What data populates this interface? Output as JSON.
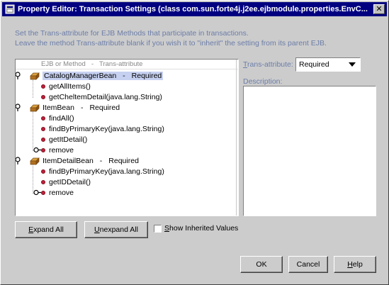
{
  "window": {
    "title": "Property Editor: Transaction Settings (class com.sun.forte4j.j2ee.ejbmodule.properties.EnvC...",
    "close_glyph": "✕"
  },
  "instructions": {
    "line1": "Set the Trans-attribute for EJB Methods that participate in transactions.",
    "line2": "Leave the method Trans-attribute blank if you wish it to \"inherit\" the setting from its parent EJB."
  },
  "tree": {
    "header": {
      "col1": "EJB or Method",
      "sep": "-",
      "col2": "Trans-attribute"
    },
    "beans": [
      {
        "name": "CatalogManagerBean",
        "sep": "-",
        "attr": "Required",
        "selected": true,
        "methods": [
          "getAllItems()",
          "getCheltemDetail(java.lang.String)"
        ]
      },
      {
        "name": "ItemBean",
        "sep": "-",
        "attr": "Required",
        "selected": false,
        "methods": [
          "findAll()",
          "findByPrimaryKey(java.lang.String)",
          "getItDetail()",
          "remove"
        ]
      },
      {
        "name": "ItemDetailBean",
        "sep": "-",
        "attr": "Required",
        "selected": false,
        "methods": [
          "findByPrimaryKey(java.lang.String)",
          "getIDDetail()",
          "remove"
        ]
      }
    ]
  },
  "trans_attribute": {
    "label_prefix": "T",
    "label_rest": "rans-attribute:",
    "value": "Required"
  },
  "description": {
    "label": "Description:"
  },
  "buttons": {
    "expand_all": {
      "mnemonic": "E",
      "rest": "xpand All"
    },
    "unexpand_all": {
      "mnemonic": "U",
      "rest": "nexpand All"
    },
    "ok": "OK",
    "cancel": "Cancel",
    "help": {
      "mnemonic": "H",
      "rest": "elp"
    }
  },
  "show_inherited": {
    "mnemonic": "S",
    "rest": "how Inherited Values",
    "checked": false
  },
  "colors": {
    "title_bg": "#000080",
    "hint_text": "#6b7da8",
    "selection": "#c6d0f0",
    "method_dot": "#c0203a"
  }
}
